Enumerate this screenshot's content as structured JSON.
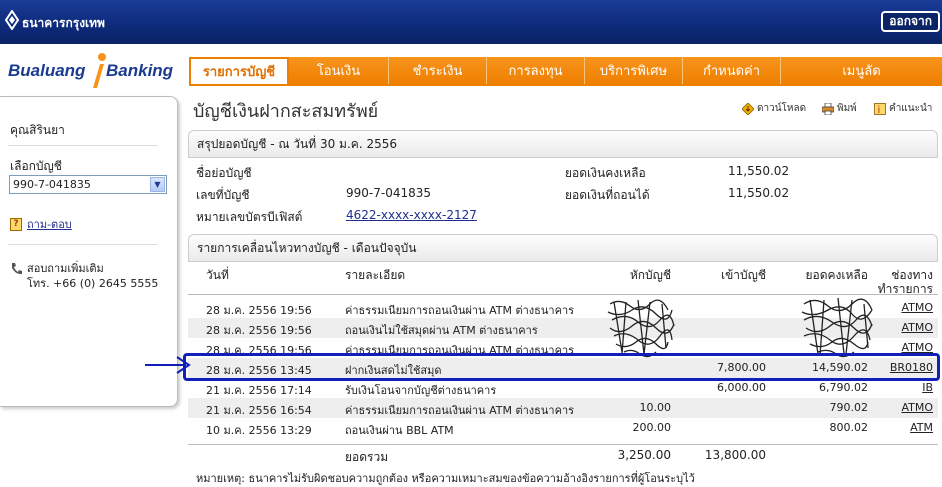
{
  "topbar": {
    "bank_name": "ธนาคารกรุงเทพ",
    "logout_label": "ออกจาก"
  },
  "brand": {
    "left": "Bualuang",
    "right": "Banking"
  },
  "nav": {
    "tabs": [
      {
        "label": "รายการบัญชี",
        "active": true
      },
      {
        "label": "โอนเงิน"
      },
      {
        "label": "ชำระเงิน"
      },
      {
        "label": "การลงทุน"
      },
      {
        "label": "บริการพิเศษ"
      },
      {
        "label": "กำหนดค่า"
      },
      {
        "label": "เมนูลัด"
      }
    ]
  },
  "sidebar": {
    "username": "คุณสิรินยา",
    "account_label": "เลือกบัญชี",
    "account_selected": "990-7-041835",
    "faq_label": "ถาม-ตอบ",
    "contact_line1": "สอบถามเพิ่มเติม",
    "contact_line2": "โทร. +66 (0) 2645 5555"
  },
  "main": {
    "page_title": "บัญชีเงินฝากสะสมทรัพย์",
    "actions": {
      "download": "ดาวน์โหลด",
      "print": "พิมพ์",
      "help": "คำแนะนำ"
    },
    "summary_header": "สรุปยอดบัญชี - ณ วันที่ 30 ม.ค. 2556",
    "summary": {
      "short_name_label": "ชื่อย่อบัญชี",
      "account_no_label": "เลขที่บัญชี",
      "account_no": "990-7-041835",
      "card_label": "หมายเลขบัตรบีเฟิสต์",
      "card_no": "4622-xxxx-xxxx-2127",
      "balance_label": "ยอดเงินคงเหลือ",
      "balance": "11,550.02",
      "available_label": "ยอดเงินที่ถอนได้",
      "available": "11,550.02"
    },
    "txn_header": "รายการเคลื่อนไหวทางบัญชี - เดือนปัจจุบัน",
    "columns": {
      "date": "วันที่",
      "desc": "รายละเอียด",
      "debit": "หักบัญชี",
      "credit": "เข้าบัญชี",
      "balance": "ยอดคงเหลือ",
      "channel_1": "ช่องทาง",
      "channel_2": "ทำรายการ"
    },
    "rows": [
      {
        "date": "28 ม.ค. 2556 19:56",
        "desc": "ค่าธรรมเนียมการถอนเงินผ่าน ATM ต่างธนาคาร",
        "debit": "",
        "credit": "",
        "balance": "",
        "channel": "ATMO"
      },
      {
        "date": "28 ม.ค. 2556 19:56",
        "desc": "ถอนเงินไม่ใช้สมุดผ่าน ATM ต่างธนาคาร",
        "debit": "",
        "credit": "",
        "balance": "",
        "channel": "ATMO"
      },
      {
        "date": "28 ม.ค. 2556 19:56",
        "desc": "ค่าธรรมเนียมการถอนเงินผ่าน ATM ต่างธนาคาร",
        "debit": "",
        "credit": "",
        "balance": "",
        "channel": "ATMO"
      },
      {
        "date": "28 ม.ค. 2556 13:45",
        "desc": "ฝากเงินสดไม่ใช้สมุด",
        "debit": "",
        "credit": "7,800.00",
        "balance": "14,590.02",
        "channel": "BR0180"
      },
      {
        "date": "21 ม.ค. 2556 17:14",
        "desc": "รับเงินโอนจากบัญชีต่างธนาคาร",
        "debit": "",
        "credit": "6,000.00",
        "balance": "6,790.02",
        "channel": "IB"
      },
      {
        "date": "21 ม.ค. 2556 16:54",
        "desc": "ค่าธรรมเนียมการถอนเงินผ่าน ATM ต่างธนาคาร",
        "debit": "10.00",
        "credit": "",
        "balance": "790.02",
        "channel": "ATMO"
      },
      {
        "date": "10 ม.ค. 2556 13:29",
        "desc": "ถอนเงินผ่าน BBL ATM",
        "debit": "200.00",
        "credit": "",
        "balance": "800.02",
        "channel": "ATM"
      }
    ],
    "total_label": "ยอดรวม",
    "total_debit": "3,250.00",
    "total_credit": "13,800.00",
    "note": "หมายเหตุ: ธนาคารไม่รับผิดชอบความถูกต้อง หรือความเหมาะสมของข้อความอ้างอิงรายการที่ผู้โอนระบุไว้"
  },
  "colors": {
    "nav_orange": "#ee7f00",
    "topbar_blue": "#0d2a7a",
    "annotation_blue": "#1020b8"
  }
}
